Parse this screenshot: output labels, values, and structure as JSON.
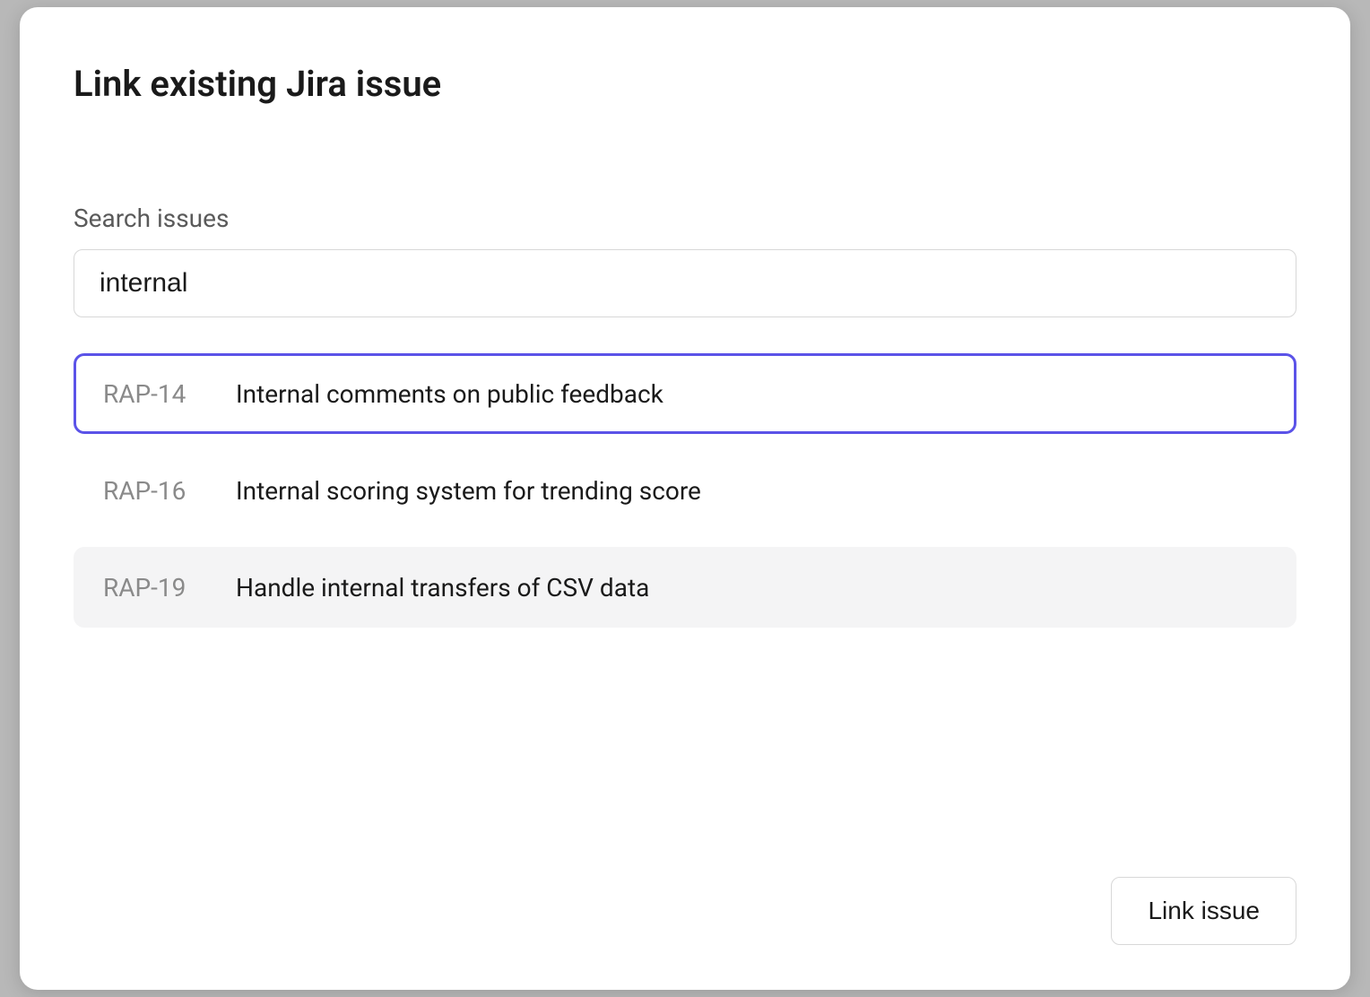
{
  "modal": {
    "title": "Link existing Jira issue",
    "search_label": "Search issues",
    "search_value": "internal",
    "link_button_label": "Link issue"
  },
  "results": [
    {
      "key": "RAP-14",
      "title": "Internal comments on public feedback",
      "selected": true,
      "hovered": false
    },
    {
      "key": "RAP-16",
      "title": "Internal scoring system for trending score",
      "selected": false,
      "hovered": false
    },
    {
      "key": "RAP-19",
      "title": "Handle internal transfers of CSV data",
      "selected": false,
      "hovered": true
    }
  ]
}
